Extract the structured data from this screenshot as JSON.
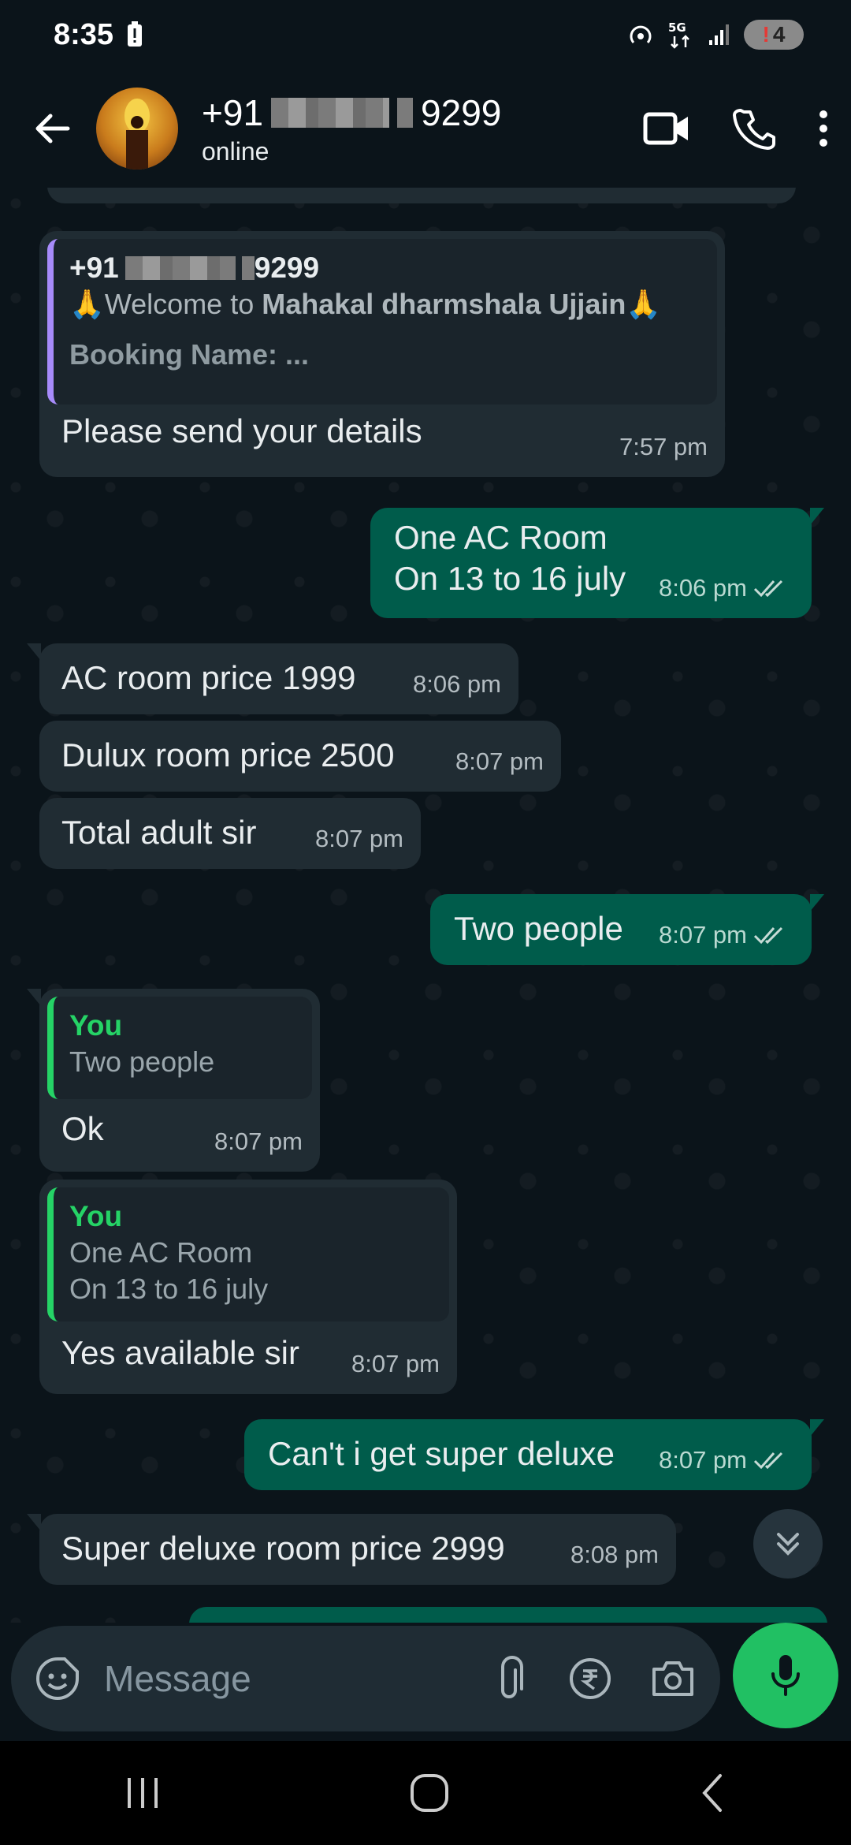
{
  "status_bar": {
    "time": "8:35",
    "network": "5G",
    "notification_count": "4"
  },
  "header": {
    "number_prefix": "+91",
    "number_suffix": "9299",
    "status": "online"
  },
  "messages": [
    {
      "dir": "in",
      "quote_name_prefix": "+91",
      "quote_name_suffix": "9299",
      "quote_line1": "🙏Welcome to ",
      "quote_bold": "Mahakal dharmshala Ujjain",
      "quote_line1_end": "🙏",
      "quote_line2": "Booking Name: ...",
      "text": "Please send your details",
      "time": "7:57 pm"
    },
    {
      "dir": "out",
      "text_line1": "One AC Room",
      "text_line2": "On 13 to 16 july",
      "time": "8:06 pm"
    },
    {
      "dir": "in",
      "text": "AC room price 1999",
      "time": "8:06 pm"
    },
    {
      "dir": "in",
      "text": "Dulux room price 2500",
      "time": "8:07 pm"
    },
    {
      "dir": "in",
      "text": "Total adult sir",
      "time": "8:07 pm"
    },
    {
      "dir": "out",
      "text": "Two people",
      "time": "8:07 pm"
    },
    {
      "dir": "in",
      "quote_name": "You",
      "quote_text": "Two people",
      "text": "Ok",
      "time": "8:07 pm"
    },
    {
      "dir": "in",
      "quote_name": "You",
      "quote_line1": "One AC Room",
      "quote_line2": "On 13 to 16 july",
      "text": "Yes available sir",
      "time": "8:07 pm"
    },
    {
      "dir": "out",
      "text": "Can't i get super deluxe",
      "time": "8:07 pm"
    },
    {
      "dir": "in",
      "text": "Super deluxe room price 2999",
      "time": "8:08 pm"
    }
  ],
  "input": {
    "placeholder": "Message"
  },
  "colors": {
    "incoming": "#202c33",
    "outgoing": "#005c4b",
    "accent": "#21c063",
    "background": "#0b141a"
  }
}
